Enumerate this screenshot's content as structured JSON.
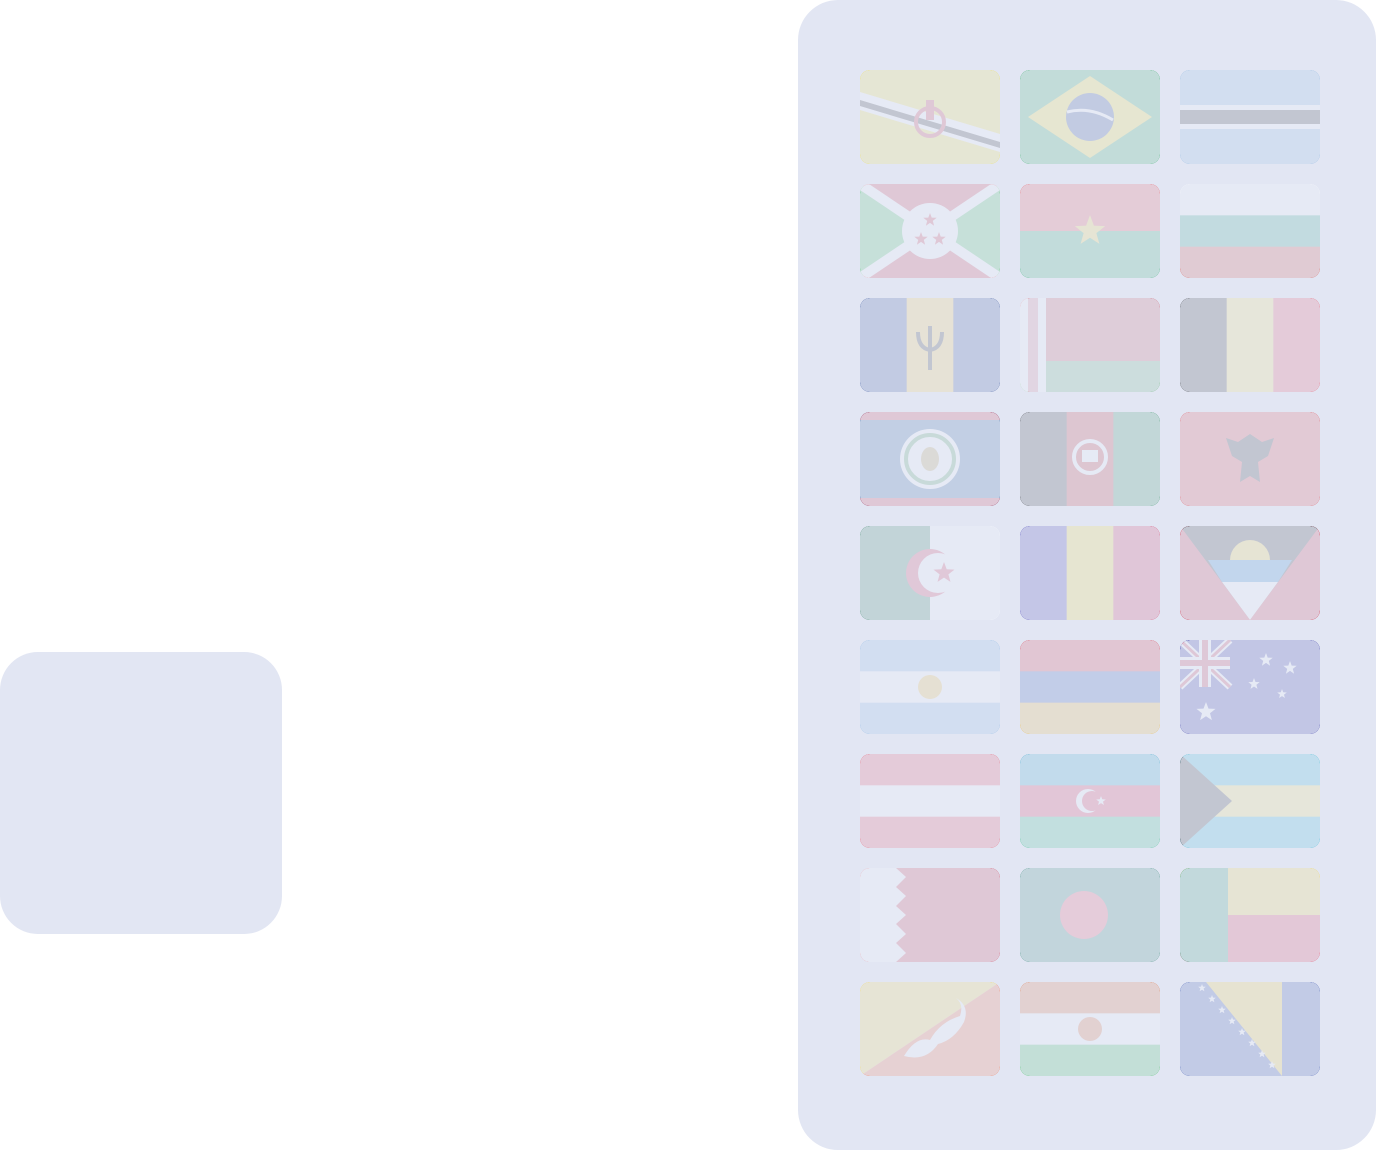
{
  "theme": {
    "slot_color": "#e2e6f3",
    "panel_color": "#e2e6f3",
    "veil_opacity": 0.86
  },
  "flags": [
    {
      "icon": "brunei-flag-icon"
    },
    {
      "icon": "brazil-flag-icon"
    },
    {
      "icon": "botswana-flag-icon"
    },
    {
      "icon": "burundi-flag-icon"
    },
    {
      "icon": "burkina-faso-flag-icon"
    },
    {
      "icon": "bulgaria-flag-icon"
    },
    {
      "icon": "barbados-flag-icon"
    },
    {
      "icon": "belarus-flag-icon"
    },
    {
      "icon": "belgium-flag-icon"
    },
    {
      "icon": "belize-flag-icon"
    },
    {
      "icon": "afghanistan-flag-icon"
    },
    {
      "icon": "albania-flag-icon"
    },
    {
      "icon": "algeria-flag-icon"
    },
    {
      "icon": "andorra-flag-icon"
    },
    {
      "icon": "antigua-and-barbuda-flag-icon"
    },
    {
      "icon": "argentina-flag-icon"
    },
    {
      "icon": "armenia-flag-icon"
    },
    {
      "icon": "australia-flag-icon"
    },
    {
      "icon": "austria-flag-icon"
    },
    {
      "icon": "azerbaijan-flag-icon"
    },
    {
      "icon": "bahamas-flag-icon"
    },
    {
      "icon": "bahrain-flag-icon"
    },
    {
      "icon": "bangladesh-flag-icon"
    },
    {
      "icon": "benin-flag-icon"
    },
    {
      "icon": "bhutan-flag-icon"
    },
    {
      "icon": "niger-flag-icon"
    },
    {
      "icon": "bosnia-and-herzegovina-flag-icon"
    }
  ]
}
